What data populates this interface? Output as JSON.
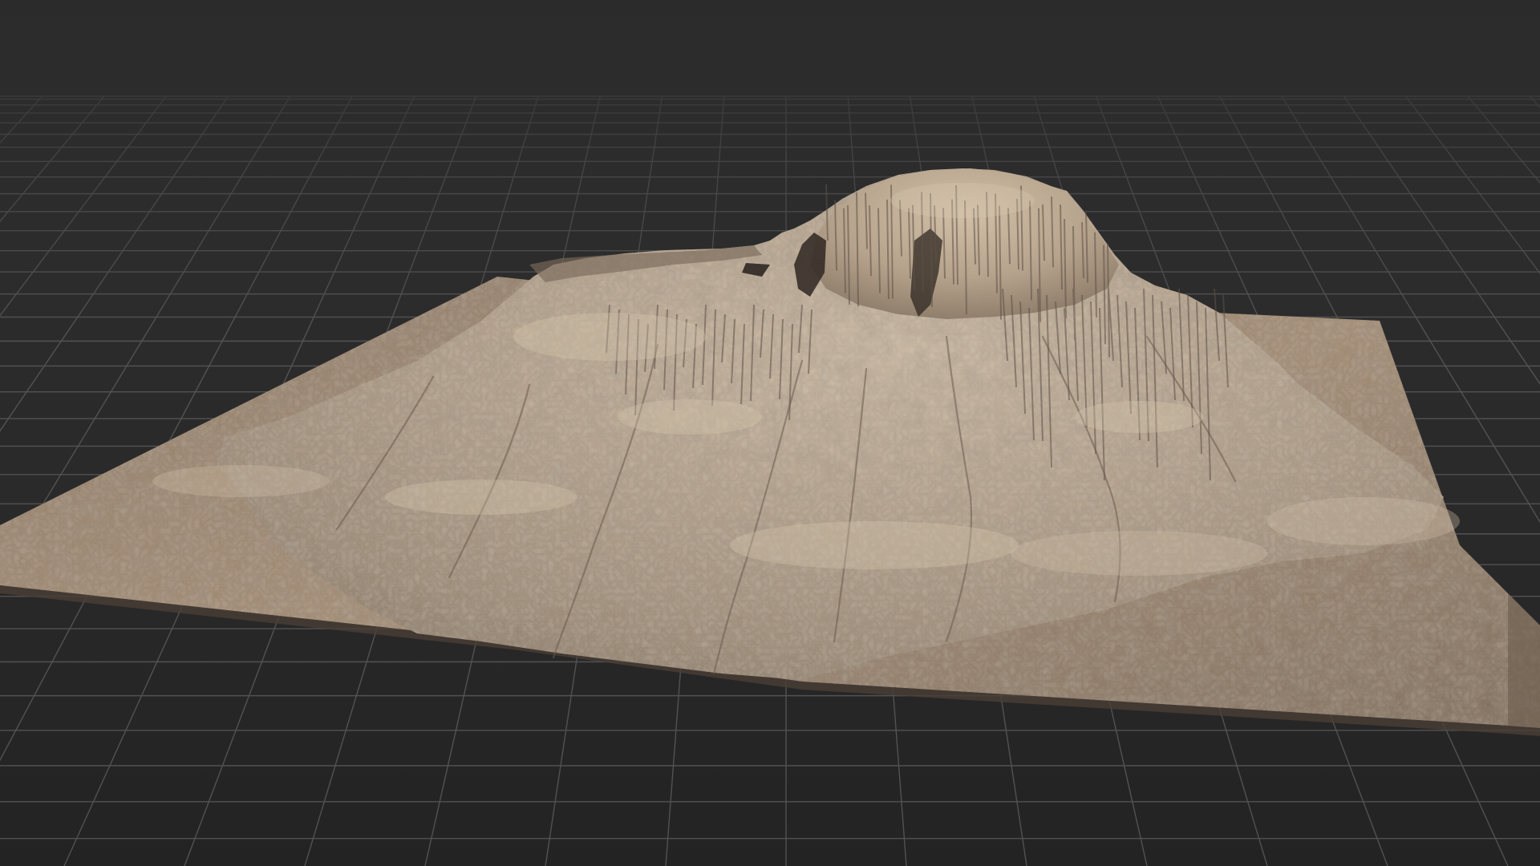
{
  "viewport": {
    "kind": "3d-terrain-viewport",
    "background_color": "#2b2b2b",
    "grid": {
      "visible": true,
      "line_color": "#5a5a5a",
      "minor_line_color": "#3d3d3d"
    },
    "terrain": {
      "visible": true,
      "ground_color": "#a08a72",
      "rock_light_color": "#c8b59c",
      "rock_dark_color": "#5e5046",
      "shadow_color": "#2a2420"
    }
  }
}
